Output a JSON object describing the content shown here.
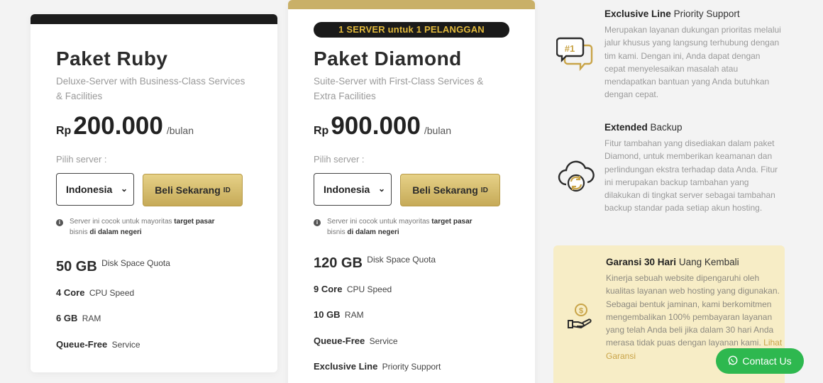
{
  "ruby": {
    "name": "Paket Ruby",
    "subtitle": "Deluxe-Server with Business-Class Services & Facilities",
    "currency": "Rp",
    "price": "200.000",
    "per": "/bulan",
    "pilih_label": "Pilih server :",
    "server_select": "Indonesia",
    "buy_label": "Beli Sekarang",
    "buy_flag": "ID",
    "note": {
      "text_1": "Server ini cocok untuk mayoritas",
      "bold_1": "target pasar",
      "text_2": "bisnis",
      "bold_2": "di dalam negeri"
    },
    "features": [
      {
        "value": "50 GB",
        "label": "Disk Space Quota"
      },
      {
        "value": "4 Core",
        "label": "CPU Speed"
      },
      {
        "value": "6 GB",
        "label": "RAM"
      },
      {
        "value": "Queue-Free",
        "label": "Service"
      }
    ]
  },
  "diamond": {
    "ribbon": "1 SERVER untuk 1 PELANGGAN",
    "name": "Paket Diamond",
    "subtitle": "Suite-Server with First-Class Services & Extra Facilities",
    "currency": "Rp",
    "price": "900.000",
    "per": "/bulan",
    "pilih_label": "Pilih server :",
    "server_select": "Indonesia",
    "buy_label": "Beli Sekarang",
    "buy_flag": "ID",
    "note": {
      "text_1": "Server ini cocok untuk mayoritas",
      "bold_1": "target pasar",
      "text_2": "bisnis",
      "bold_2": "di dalam negeri"
    },
    "features": [
      {
        "value": "120 GB",
        "label": "Disk Space Quota"
      },
      {
        "value": "9 Core",
        "label": "CPU Speed"
      },
      {
        "value": "10 GB",
        "label": "RAM"
      },
      {
        "value": "Queue-Free",
        "label": "Service"
      },
      {
        "value": "Exclusive Line",
        "label": "Priority Support"
      }
    ]
  },
  "benefits": [
    {
      "title_bold": "Exclusive Line",
      "title_rest": "Priority Support",
      "desc": "Merupakan layanan dukungan prioritas melalui jalur khusus yang langsung terhubung dengan tim kami. Dengan ini, Anda dapat dengan cepat menyelesaikan masalah atau mendapatkan bantuan yang Anda butuhkan dengan cepat.",
      "icon": "support-chat-icon",
      "icon_text": "#1"
    },
    {
      "title_bold": "Extended",
      "title_rest": "Backup",
      "desc": "Fitur tambahan yang disediakan dalam paket Diamond, untuk memberikan keamanan dan perlindungan ekstra terhadap data Anda. Fitur ini merupakan backup tambahan yang dilakukan di tingkat server sebagai tambahan backup standar pada setiap akun hosting.",
      "icon": "cloud-backup-icon"
    }
  ],
  "guarantee": {
    "title_bold": "Garansi 30 Hari",
    "title_rest": "Uang Kembali",
    "desc": "Kinerja sebuah website dipengaruhi oleh kualitas layanan web hosting yang digunakan. Sebagai bentuk jaminan, kami berkomitmen mengembalikan 100% pembayaran layanan yang telah Anda beli jika dalam 30 hari Anda merasa tidak puas dengan layanan kami.",
    "link": "Lihat Garansi",
    "icon": "money-back-hand-icon",
    "icon_symbol": "$"
  },
  "contact": {
    "label": "Contact Us",
    "icon": "whatsapp-icon"
  },
  "colors": {
    "gold": "#c9b068",
    "gold_button": "#dcc273",
    "dark": "#1c1c1c",
    "guarantee_bg": "#f7edc6",
    "whatsapp_green": "#2eb84f",
    "ribbon_text": "#e2b93b"
  }
}
